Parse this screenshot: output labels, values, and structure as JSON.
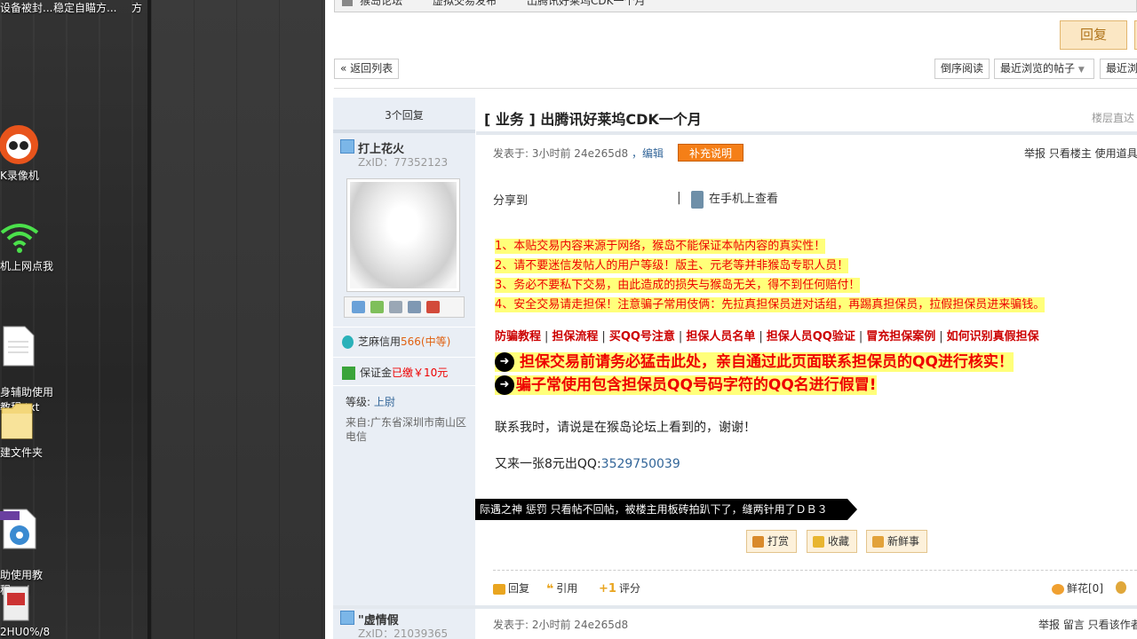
{
  "desktop": {
    "top_items": [
      "设备被封...",
      "稳定自瞄方...",
      "方"
    ],
    "icons": [
      {
        "label": "K录像机",
        "icon": "recorder-icon"
      },
      {
        "label": "机上网点我",
        "icon": "wifi-icon"
      },
      {
        "label": "身辅助使用\n教程.txt",
        "icon": "text-file-icon"
      },
      {
        "label": "建文件夹",
        "icon": "folder-icon"
      },
      {
        "label": "助使用教\n程.avi",
        "icon": "video-file-icon"
      },
      {
        "label": "2HU0%/8",
        "icon": "file-icon"
      }
    ]
  },
  "breadcrumb": [
    "猴岛论坛",
    "虚拟交易发布",
    "出腾讯好莱坞CDK一个月"
  ],
  "toolbar": {
    "reply_label": "回复",
    "back_label": "« 返回列表",
    "reverse_label": "倒序阅读",
    "recent_label": "最近浏览的帖子",
    "recent2_label": "最近浏"
  },
  "thread": {
    "reply_count": "3个回复",
    "title": "[ 业务 ] 出腾讯好莱坞CDK一个月",
    "floor_link": "楼层直达"
  },
  "author": {
    "name": "打上花火",
    "zxid": "ZxID：77352123",
    "credit_label": "芝麻信用",
    "credit_value": "566(中等)",
    "deposit_label": "保证金",
    "deposit_value": "已缴￥10元",
    "level_label": "等级:",
    "level_value": "上尉",
    "from": "来自:广东省深圳市南山区电信"
  },
  "post": {
    "meta": "发表于: 3小时前 24e265d8",
    "edit": "，编辑",
    "supplement": "补充说明",
    "actions_right": "举报   只看楼主   使用道具",
    "share": "分享到",
    "mobile": "在手机上查看",
    "warnings": [
      "1、本贴交易内容来源于网络，猴岛不能保证本帖内容的真实性！",
      "2、请不要迷信发帖人的用户等级！版主、元老等并非猴岛专职人员！",
      "3、务必不要私下交易，由此造成的损失与猴岛无关，得不到任何赔付！",
      "4、安全交易请走担保！注意骗子常用伎俩：先拉真担保员进对话组，再踢真担保员，拉假担保员进来骗钱。"
    ],
    "links": [
      "防骗教程",
      "担保流程",
      "买QQ号注意",
      "担保人员名单",
      "担保人员QQ验证",
      "冒充担保案例",
      "如何识别真假担保"
    ],
    "alerts": [
      "担保交易前请务必猛击此处，亲自通过此页面联系担保员的QQ进行核实！",
      "骗子常使用包含担保员QQ号码字符的QQ名进行假冒!"
    ],
    "contact": "联系我时，请说是在猴岛论坛上看到的，谢谢！",
    "offer": "又来一张8元出QQ:",
    "qq": "3529750039",
    "rating": "际遇之神   惩罚   只看帖不回帖，被楼主用板砖拍趴下了，缝两针用了ＤＢ３",
    "btn_tip": "打赏",
    "btn_fav": "收藏",
    "btn_news": "新鲜事",
    "act_reply": "回复",
    "act_quote": "引用",
    "act_rate": "评分",
    "act_flower": "鲜花[0]"
  },
  "post2": {
    "name": "\"虚情假",
    "zxid": "ZxID：21039365",
    "meta": "发表于: 2小时前 24e265d8",
    "actions_right": "举报   留言   只看该作者"
  }
}
